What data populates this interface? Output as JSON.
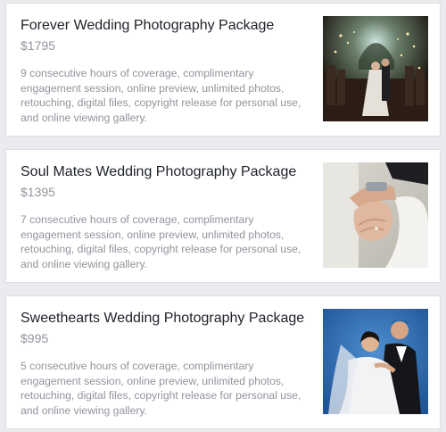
{
  "packages": [
    {
      "title": "Forever Wedding Photography Package",
      "price": "$1795",
      "description": "9 consecutive hours of coverage, complimentary engagement session, online preview, unlimited photos, retouching, digital files, copyright release for personal use, and online viewing gallery."
    },
    {
      "title": "Soul Mates Wedding Photography Package",
      "price": "$1395",
      "description": "7 consecutive hours of coverage, complimentary engagement session, online preview, unlimited photos, retouching, digital files, copyright release for personal use, and online viewing gallery."
    },
    {
      "title": "Sweethearts Wedding Photography Package",
      "price": "$995",
      "description": "5 consecutive hours of coverage, complimentary engagement session, online preview, unlimited photos, retouching, digital files, copyright release for personal use, and online viewing gallery."
    }
  ],
  "colors": {
    "background": "#e9ebee",
    "card": "#ffffff",
    "title": "#1d2129",
    "muted": "#90949c"
  }
}
